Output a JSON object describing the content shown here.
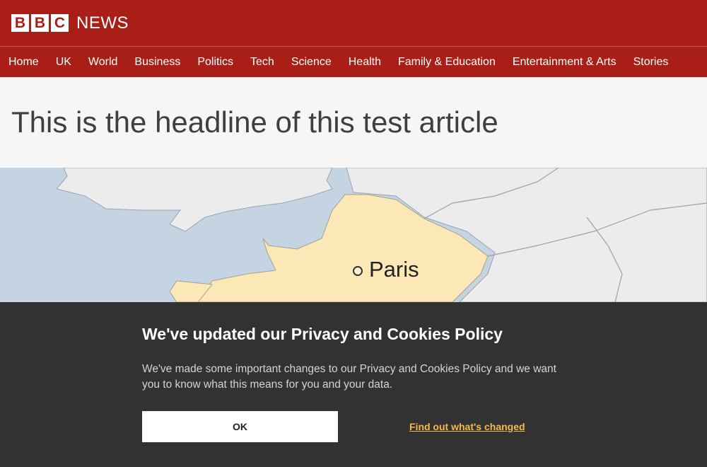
{
  "brand": {
    "letters": [
      "B",
      "B",
      "C"
    ],
    "word": "NEWS",
    "color": "#a91f17"
  },
  "nav": {
    "items": [
      "Home",
      "UK",
      "World",
      "Business",
      "Politics",
      "Tech",
      "Science",
      "Health",
      "Family & Education",
      "Entertainment & Arts",
      "Stories"
    ]
  },
  "article": {
    "headline": "This is the headline of this test article"
  },
  "map": {
    "city_label": "Paris",
    "land_color": "#ececec",
    "france_color": "#fbe8b6",
    "sea_color": "#c5d4e3"
  },
  "cookie": {
    "title": "We've updated our Privacy and Cookies Policy",
    "body": "We've made some important changes to our Privacy and Cookies Policy and we want you to know what this means for you and your data.",
    "ok_label": "OK",
    "link_label": "Find out what's changed",
    "link_color": "#f3b94a"
  }
}
